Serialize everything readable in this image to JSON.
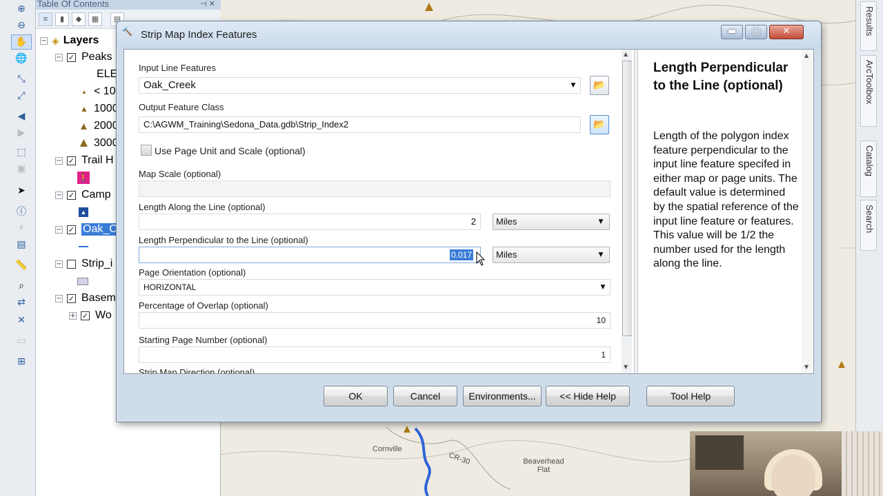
{
  "toc": {
    "title": "Table Of Contents",
    "root_label": "Layers",
    "layers": [
      {
        "label": "Peaks",
        "checked": true
      },
      {
        "label": "ELE",
        "checked": null
      },
      {
        "label": "< 10",
        "checked": null
      },
      {
        "label": "1000",
        "checked": null
      },
      {
        "label": "2000",
        "checked": null
      },
      {
        "label": "3000",
        "checked": null
      },
      {
        "label": "Trail H",
        "checked": true
      },
      {
        "label": "Camp",
        "checked": true
      },
      {
        "label": "Oak_C",
        "checked": true
      },
      {
        "label": "Strip_i",
        "checked": false
      },
      {
        "label": "Basem",
        "checked": true
      },
      {
        "label": "Wo",
        "checked": true
      }
    ]
  },
  "map": {
    "labels": [
      "Cornville",
      "CR-30",
      "Beaverhead Flat"
    ]
  },
  "right_dock": {
    "tabs": [
      "Results",
      "ArcToolbox",
      "Catalog",
      "Search"
    ]
  },
  "dialog": {
    "title": "Strip Map Index Features",
    "params": {
      "input_line_features": {
        "label": "Input Line Features",
        "value": "Oak_Creek"
      },
      "output_feature_class": {
        "label": "Output Feature Class",
        "value": "C:\\AGWM_Training\\Sedona_Data.gdb\\Strip_Index2"
      },
      "use_page_unit": {
        "label": "Use Page Unit and Scale (optional)",
        "checked": false
      },
      "map_scale": {
        "label": "Map Scale (optional)",
        "value": ""
      },
      "length_along": {
        "label": "Length Along the Line (optional)",
        "value": "2",
        "unit": "Miles"
      },
      "length_perpendicular": {
        "label": "Length Perpendicular to the Line (optional)",
        "value": "0.017",
        "unit": "Miles"
      },
      "page_orientation": {
        "label": "Page Orientation (optional)",
        "value": "HORIZONTAL"
      },
      "percentage_overlap": {
        "label": "Percentage of Overlap (optional)",
        "value": "10"
      },
      "starting_page": {
        "label": "Starting Page Number (optional)",
        "value": "1"
      },
      "strip_direction": {
        "label": "Strip Map Direction (optional)"
      }
    },
    "help": {
      "title": "Length Perpendicular to the Line (optional)",
      "body": "Length of the polygon index feature perpendicular to the input line feature specifed in either map or page units. The default value is determined by the spatial reference of the input line feature or features. This value will be 1/2 the number used for the length along the line."
    },
    "buttons": {
      "ok": "OK",
      "cancel": "Cancel",
      "environments": "Environments...",
      "hide_help": "<< Hide Help",
      "tool_help": "Tool Help"
    }
  }
}
